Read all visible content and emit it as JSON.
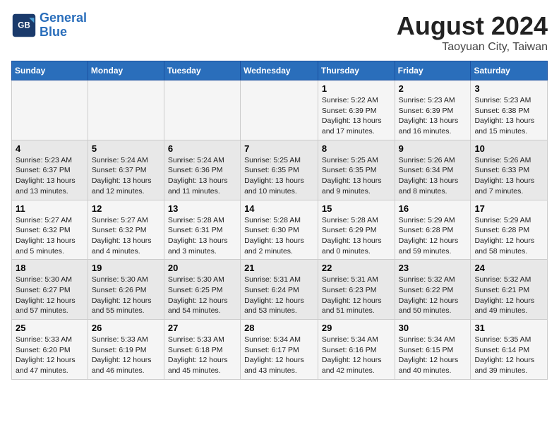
{
  "header": {
    "logo_line1": "General",
    "logo_line2": "Blue",
    "main_title": "August 2024",
    "subtitle": "Taoyuan City, Taiwan"
  },
  "days_of_week": [
    "Sunday",
    "Monday",
    "Tuesday",
    "Wednesday",
    "Thursday",
    "Friday",
    "Saturday"
  ],
  "weeks": [
    {
      "cells": [
        {
          "day": "",
          "content": ""
        },
        {
          "day": "",
          "content": ""
        },
        {
          "day": "",
          "content": ""
        },
        {
          "day": "",
          "content": ""
        },
        {
          "day": "1",
          "content": "Sunrise: 5:22 AM\nSunset: 6:39 PM\nDaylight: 13 hours\nand 17 minutes."
        },
        {
          "day": "2",
          "content": "Sunrise: 5:23 AM\nSunset: 6:39 PM\nDaylight: 13 hours\nand 16 minutes."
        },
        {
          "day": "3",
          "content": "Sunrise: 5:23 AM\nSunset: 6:38 PM\nDaylight: 13 hours\nand 15 minutes."
        }
      ]
    },
    {
      "cells": [
        {
          "day": "4",
          "content": "Sunrise: 5:23 AM\nSunset: 6:37 PM\nDaylight: 13 hours\nand 13 minutes."
        },
        {
          "day": "5",
          "content": "Sunrise: 5:24 AM\nSunset: 6:37 PM\nDaylight: 13 hours\nand 12 minutes."
        },
        {
          "day": "6",
          "content": "Sunrise: 5:24 AM\nSunset: 6:36 PM\nDaylight: 13 hours\nand 11 minutes."
        },
        {
          "day": "7",
          "content": "Sunrise: 5:25 AM\nSunset: 6:35 PM\nDaylight: 13 hours\nand 10 minutes."
        },
        {
          "day": "8",
          "content": "Sunrise: 5:25 AM\nSunset: 6:35 PM\nDaylight: 13 hours\nand 9 minutes."
        },
        {
          "day": "9",
          "content": "Sunrise: 5:26 AM\nSunset: 6:34 PM\nDaylight: 13 hours\nand 8 minutes."
        },
        {
          "day": "10",
          "content": "Sunrise: 5:26 AM\nSunset: 6:33 PM\nDaylight: 13 hours\nand 7 minutes."
        }
      ]
    },
    {
      "cells": [
        {
          "day": "11",
          "content": "Sunrise: 5:27 AM\nSunset: 6:32 PM\nDaylight: 13 hours\nand 5 minutes."
        },
        {
          "day": "12",
          "content": "Sunrise: 5:27 AM\nSunset: 6:32 PM\nDaylight: 13 hours\nand 4 minutes."
        },
        {
          "day": "13",
          "content": "Sunrise: 5:28 AM\nSunset: 6:31 PM\nDaylight: 13 hours\nand 3 minutes."
        },
        {
          "day": "14",
          "content": "Sunrise: 5:28 AM\nSunset: 6:30 PM\nDaylight: 13 hours\nand 2 minutes."
        },
        {
          "day": "15",
          "content": "Sunrise: 5:28 AM\nSunset: 6:29 PM\nDaylight: 13 hours\nand 0 minutes."
        },
        {
          "day": "16",
          "content": "Sunrise: 5:29 AM\nSunset: 6:28 PM\nDaylight: 12 hours\nand 59 minutes."
        },
        {
          "day": "17",
          "content": "Sunrise: 5:29 AM\nSunset: 6:28 PM\nDaylight: 12 hours\nand 58 minutes."
        }
      ]
    },
    {
      "cells": [
        {
          "day": "18",
          "content": "Sunrise: 5:30 AM\nSunset: 6:27 PM\nDaylight: 12 hours\nand 57 minutes."
        },
        {
          "day": "19",
          "content": "Sunrise: 5:30 AM\nSunset: 6:26 PM\nDaylight: 12 hours\nand 55 minutes."
        },
        {
          "day": "20",
          "content": "Sunrise: 5:30 AM\nSunset: 6:25 PM\nDaylight: 12 hours\nand 54 minutes."
        },
        {
          "day": "21",
          "content": "Sunrise: 5:31 AM\nSunset: 6:24 PM\nDaylight: 12 hours\nand 53 minutes."
        },
        {
          "day": "22",
          "content": "Sunrise: 5:31 AM\nSunset: 6:23 PM\nDaylight: 12 hours\nand 51 minutes."
        },
        {
          "day": "23",
          "content": "Sunrise: 5:32 AM\nSunset: 6:22 PM\nDaylight: 12 hours\nand 50 minutes."
        },
        {
          "day": "24",
          "content": "Sunrise: 5:32 AM\nSunset: 6:21 PM\nDaylight: 12 hours\nand 49 minutes."
        }
      ]
    },
    {
      "cells": [
        {
          "day": "25",
          "content": "Sunrise: 5:33 AM\nSunset: 6:20 PM\nDaylight: 12 hours\nand 47 minutes."
        },
        {
          "day": "26",
          "content": "Sunrise: 5:33 AM\nSunset: 6:19 PM\nDaylight: 12 hours\nand 46 minutes."
        },
        {
          "day": "27",
          "content": "Sunrise: 5:33 AM\nSunset: 6:18 PM\nDaylight: 12 hours\nand 45 minutes."
        },
        {
          "day": "28",
          "content": "Sunrise: 5:34 AM\nSunset: 6:17 PM\nDaylight: 12 hours\nand 43 minutes."
        },
        {
          "day": "29",
          "content": "Sunrise: 5:34 AM\nSunset: 6:16 PM\nDaylight: 12 hours\nand 42 minutes."
        },
        {
          "day": "30",
          "content": "Sunrise: 5:34 AM\nSunset: 6:15 PM\nDaylight: 12 hours\nand 40 minutes."
        },
        {
          "day": "31",
          "content": "Sunrise: 5:35 AM\nSunset: 6:14 PM\nDaylight: 12 hours\nand 39 minutes."
        }
      ]
    }
  ]
}
